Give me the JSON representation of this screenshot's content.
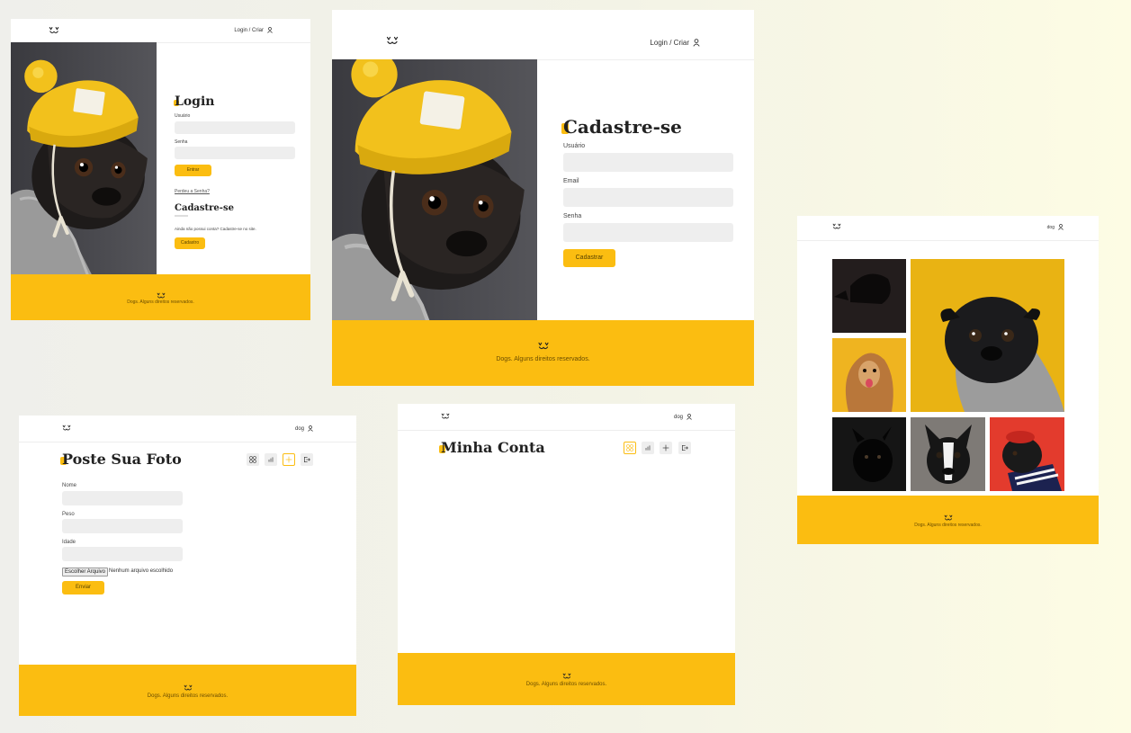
{
  "brand": {
    "accent": "#fbbd11",
    "logo_icon": "dog-face-icon",
    "user_icon": "user-icon"
  },
  "login_card": {
    "header_link": "Login / Criar",
    "title": "Login",
    "usuario_label": "Usuário",
    "senha_label": "Senha",
    "enter_button": "Entrar",
    "lost_password": "Perdeu a Senha?",
    "register_title": "Cadastre-se",
    "register_text": "Ainda não possui conta? Cadastre-se no site.",
    "register_button": "Cadastro",
    "footer": "Dogs. Alguns direitos reservados."
  },
  "signup_card": {
    "header_link": "Login / Criar",
    "title": "Cadastre-se",
    "usuario_label": "Usuário",
    "email_label": "Email",
    "senha_label": "Senha",
    "submit_button": "Cadastrar",
    "footer": "Dogs. Alguns direitos reservados."
  },
  "feed_card": {
    "header_link": "dog",
    "footer": "Dogs. Alguns direitos reservados."
  },
  "post_card": {
    "header_link": "dog",
    "title": "Poste Sua Foto",
    "nome_label": "Nome",
    "peso_label": "Peso",
    "idade_label": "Idade",
    "file_button": "Escolher Arquivo",
    "file_status": "Nenhum arquivo escolhido",
    "submit_button": "Enviar",
    "nav_icons": [
      "grid-icon",
      "stats-icon",
      "plus-icon",
      "logout-icon"
    ],
    "active_nav": "plus-icon",
    "footer": "Dogs. Alguns direitos reservados."
  },
  "account_card": {
    "header_link": "dog",
    "title": "Minha Conta",
    "nav_icons": [
      "grid-icon",
      "stats-icon",
      "plus-icon",
      "logout-icon"
    ],
    "active_nav": "grid-icon",
    "footer": "Dogs. Alguns direitos reservados."
  }
}
